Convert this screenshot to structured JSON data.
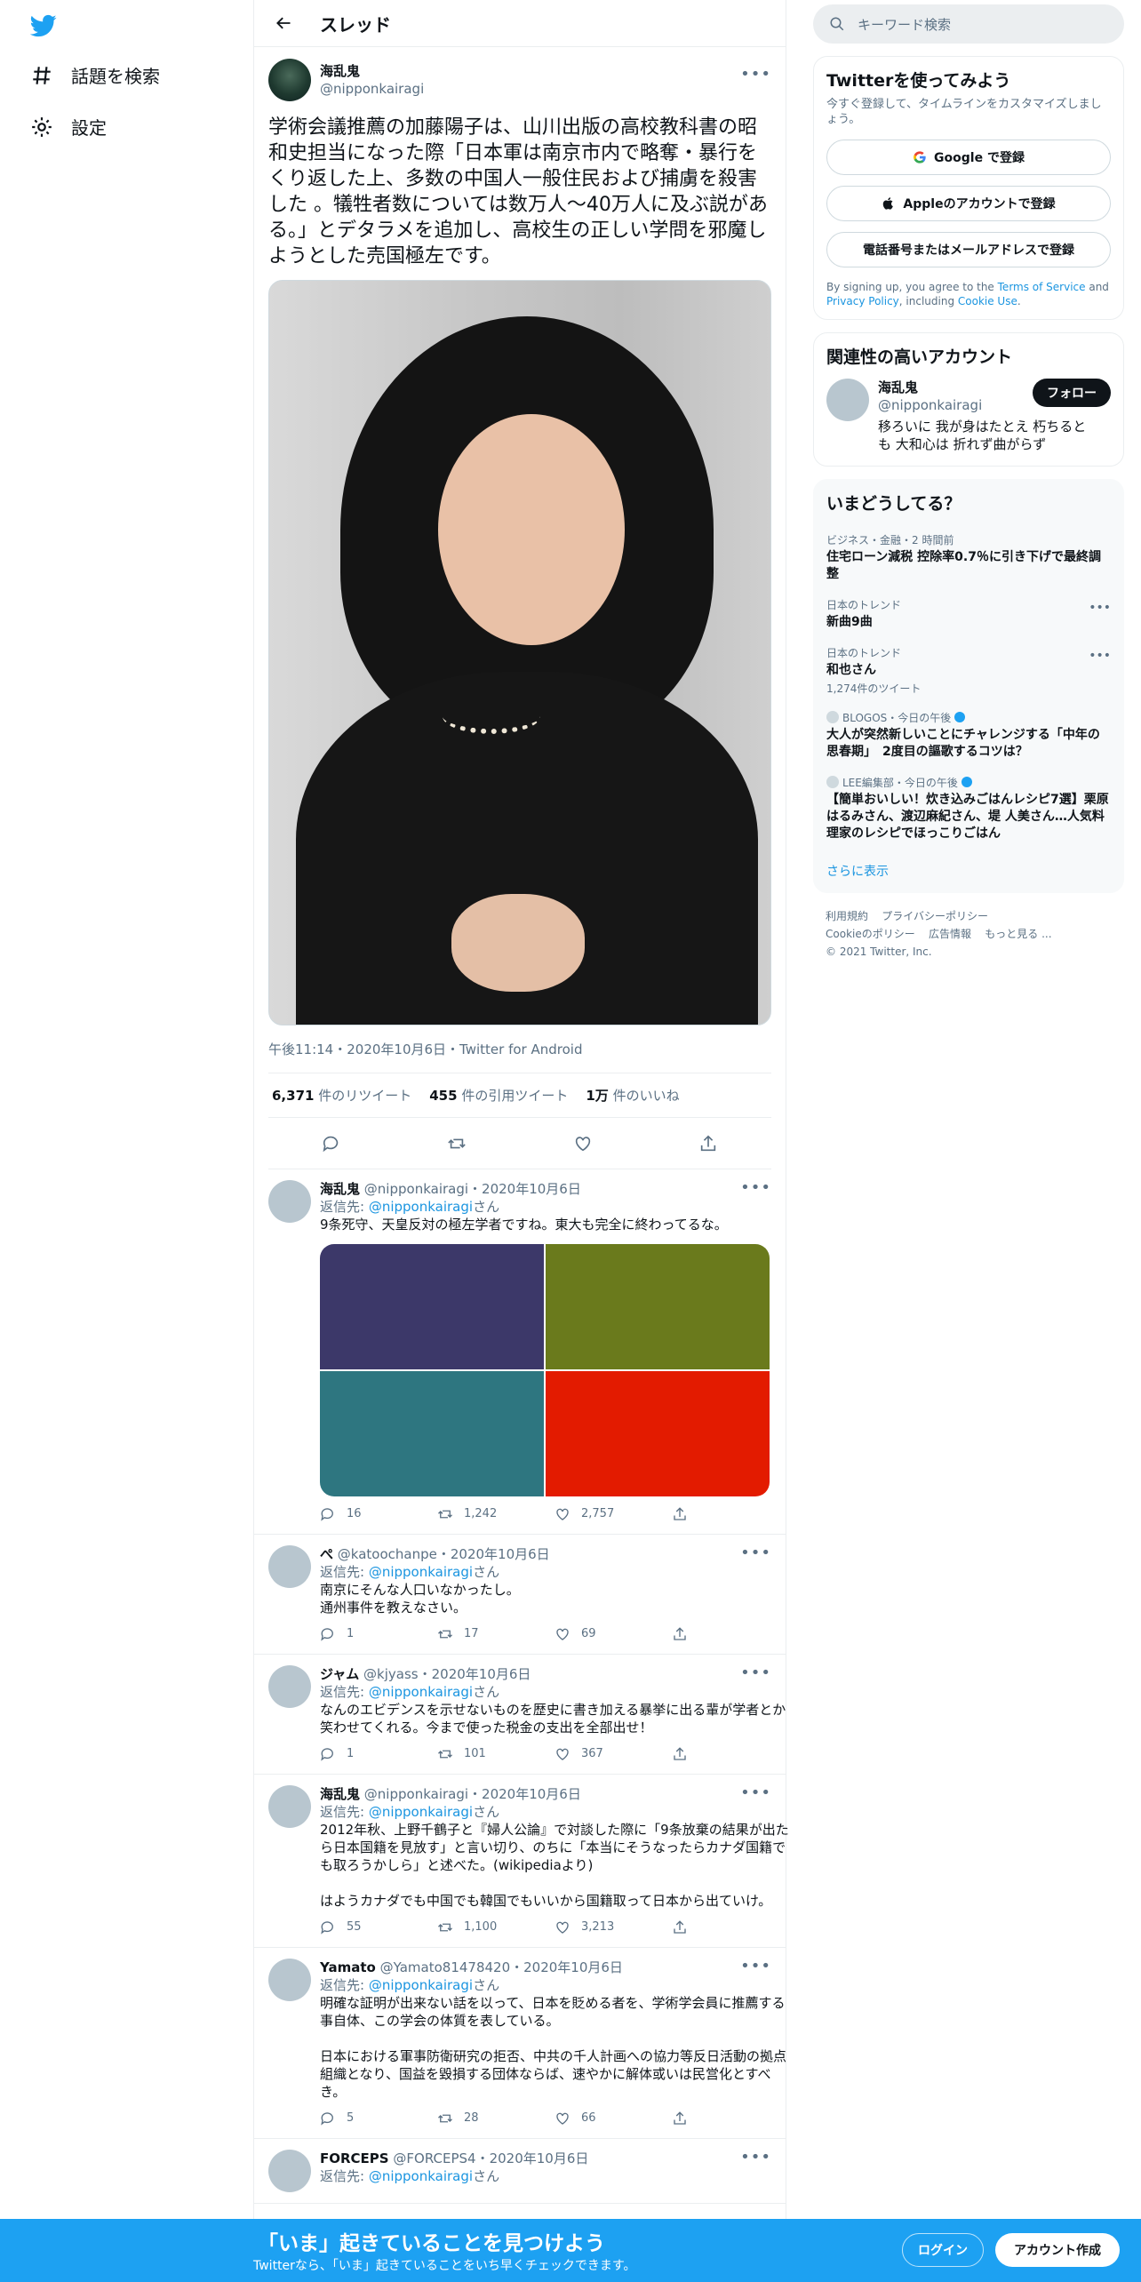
{
  "nav": {
    "explore_label": "話題を検索",
    "settings_label": "設定"
  },
  "thread": {
    "title": "スレッド",
    "author_name": "海乱鬼",
    "author_handle": "@nipponkairagi",
    "text": "学術会議推薦の加藤陽子は、山川出版の高校教科書の昭和史担当になった際「日本軍は南京市内で略奪・暴行をくり返した上、多数の中国人一般住民および捕虜を殺害した 。犠牲者数については数万人～40万人に及ぶ説がある。」とデタラメを追加し、高校生の正しい学問を邪魔しようとした売国極左です。",
    "meta": "午後11:14・2020年10月6日・Twitter for Android",
    "retweets_num": "6,371",
    "retweets_label": "件のリツイート",
    "quotes_num": "455",
    "quotes_label": "件の引用ツイート",
    "likes_num": "1万",
    "likes_label": "件のいいね"
  },
  "replies": [
    {
      "name": "海乱鬼",
      "handle": "@nipponkairagi",
      "date": "・2020年10月6日",
      "to_prefix": "返信先: ",
      "to": "@nipponkairagi",
      "to_suffix": "さん",
      "text": "9条死守、天皇反対の極左学者ですね。東大も完全に終わってるな。",
      "reply": "16",
      "retweet": "1,242",
      "like": "2,757",
      "grid_colors": [
        "#3c3869",
        "#6a7a1c",
        "#2e7680",
        "#e31b00"
      ]
    },
    {
      "name": "ぺ",
      "handle": "@katoochanpe",
      "date": "・2020年10月6日",
      "to_prefix": "返信先: ",
      "to": "@nipponkairagi",
      "to_suffix": "さん",
      "text": "南京にそんな人口いなかったし。\n通州事件を教えなさい。",
      "reply": "1",
      "retweet": "17",
      "like": "69"
    },
    {
      "name": "ジャム",
      "handle": "@kjyass",
      "date": "・2020年10月6日",
      "to_prefix": "返信先: ",
      "to": "@nipponkairagi",
      "to_suffix": "さん",
      "text": "なんのエビデンスを示せないものを歴史に書き加える暴挙に出る輩が学者とか笑わせてくれる。今まで使った税金の支出を全部出せ！",
      "reply": "1",
      "retweet": "101",
      "like": "367"
    },
    {
      "name": "海乱鬼",
      "handle": "@nipponkairagi",
      "date": "・2020年10月6日",
      "to_prefix": "返信先: ",
      "to": "@nipponkairagi",
      "to_suffix": "さん",
      "text": "2012年秋、上野千鶴子と『婦人公論』で対談した際に「9条放棄の結果が出たら日本国籍を見放す」と言い切り、のちに「本当にそうなったらカナダ国籍でも取ろうかしら」と述べた。(wikipediaより)\n\nはようカナダでも中国でも韓国でもいいから国籍取って日本から出ていけ。",
      "reply": "55",
      "retweet": "1,100",
      "like": "3,213"
    },
    {
      "name": "Yamato",
      "handle": "@Yamato81478420",
      "date": "・2020年10月6日",
      "to_prefix": "返信先: ",
      "to": "@nipponkairagi",
      "to_suffix": "さん",
      "text": "明確な証明が出来ない話を以って、日本を貶める者を、学術学会員に推薦する事自体、この学会の体質を表している。\n\n日本における軍事防衛研究の拒否、中共の千人計画への協力等反日活動の拠点組織となり、国益を毀損する団体ならば、速やかに解体或いは民営化とすべき。",
      "reply": "5",
      "retweet": "28",
      "like": "66"
    },
    {
      "name": "FORCEPS",
      "handle": "@FORCEPS4",
      "date": "・2020年10月6日",
      "to_prefix": "返信先: ",
      "to": "@nipponkairagi",
      "to_suffix": "さん",
      "text": "",
      "reply": "",
      "retweet": "",
      "like": ""
    }
  ],
  "sidebar": {
    "search_placeholder": "キーワード検索",
    "signup_title": "Twitterを使ってみよう",
    "signup_sub": "今すぐ登録して、タイムラインをカスタマイズしましょう。",
    "google_btn": "Google で登録",
    "apple_btn": "Appleのアカウントで登録",
    "phone_btn": "電話番号またはメールアドレスで登録",
    "fine_1": "By signing up, you agree to the ",
    "tos": "Terms of Service",
    "fine_2": " and ",
    "privacy": "Privacy Policy",
    "fine_3": ", including ",
    "cookie": "Cookie Use",
    "fine_4": ".",
    "related_title": "関連性の高いアカウント",
    "related_name": "海乱鬼",
    "related_handle": "@nipponkairagi",
    "related_bio": "移ろいに 我が身はたとえ 朽ちるとも 大和心は 折れず曲がらず",
    "follow_label": "フォロー",
    "trends_title": "いまどうしてる？",
    "trends": [
      {
        "ctx": "ビジネス・金融・2 時間前",
        "title": "住宅ローン減税 控除率0.7％に引き下げで最終調整",
        "count": ""
      },
      {
        "ctx": "日本のトレンド",
        "title": "新曲9曲",
        "count": ""
      },
      {
        "ctx": "日本のトレンド",
        "title": "和也さん",
        "count": "1,274件のツイート"
      },
      {
        "ctx": "BLOGOS・今日の午後",
        "title": "大人が突然新しいことにチャレンジする「中年の思春期」　2度目の謳歌するコツは？",
        "count": ""
      },
      {
        "ctx": "LEE編集部・今日の午後",
        "title": "【簡単おいしい！炊き込みごはんレシピ7選】栗原はるみさん、渡辺麻紀さん、堤 人美さん…人気料理家のレシピでほっこりごはん",
        "count": ""
      }
    ],
    "show_more": "さらに表示",
    "footer_links": [
      "利用規約",
      "プライバシーポリシー",
      "Cookieのポリシー",
      "広告情報",
      "もっと見る ..."
    ],
    "copyright": "© 2021 Twitter, Inc."
  },
  "bottombar": {
    "title": "「いま」起きていることを見つけよう",
    "sub": "Twitterなら、「いま」起きていることをいち早くチェックできます。",
    "login": "ログイン",
    "signup": "アカウント作成"
  },
  "colors": {
    "accent": "#1da1f2",
    "link": "#1b95e0"
  }
}
